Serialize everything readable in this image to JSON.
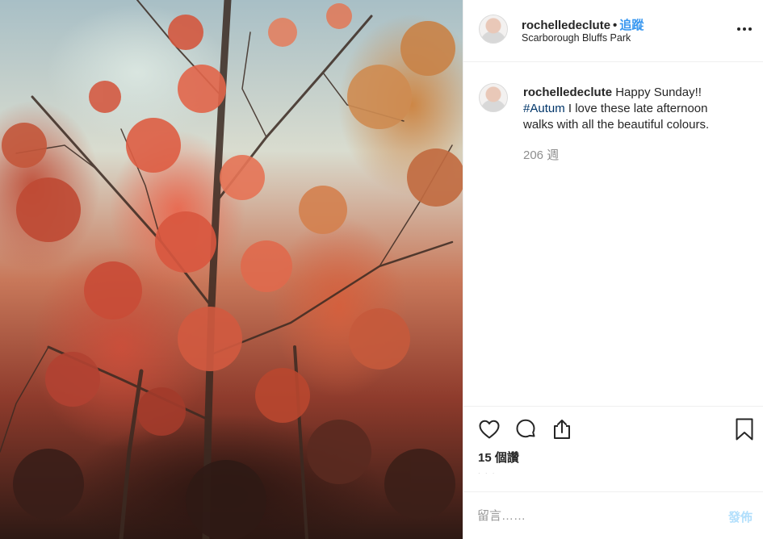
{
  "post": {
    "username": "rochelledeclute",
    "follow_label": "追蹤",
    "separator": "•",
    "location": "Scarborough Bluffs Park",
    "more_icon": "more-horizontal-icon"
  },
  "caption": {
    "username": "rochelledeclute",
    "text_before": "Happy Sunday!!",
    "hashtag": "#Autum",
    "text_after": "I love these late afternoon walks with all the beautiful colours.",
    "time_ago": "206 週"
  },
  "actions": {
    "icons": [
      "heart-icon",
      "comment-icon",
      "share-icon",
      "bookmark-icon"
    ],
    "views": "15 個讚",
    "faint_text": "· · ·"
  },
  "comment": {
    "placeholder": "留言……",
    "post_label": "發佈"
  },
  "colors": {
    "accent": "#3897f0",
    "hashtag": "#003569",
    "muted": "#8e8e8e",
    "post_disabled": "#b2dffc"
  }
}
